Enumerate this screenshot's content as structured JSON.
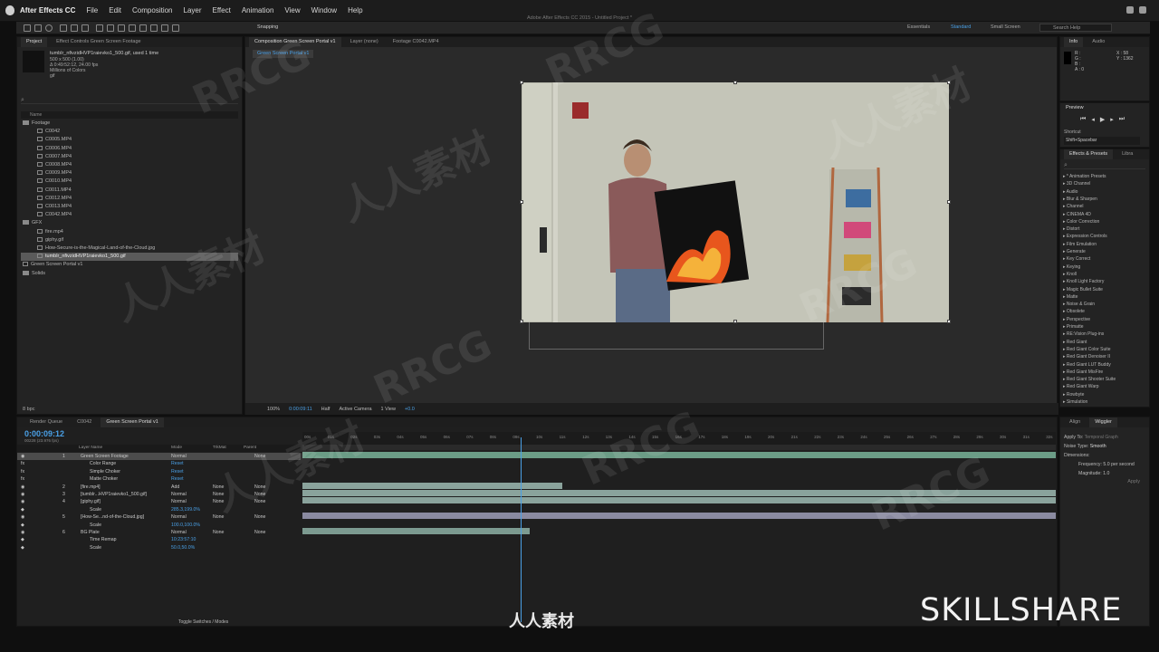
{
  "menubar": {
    "app": "After Effects CC",
    "items": [
      "File",
      "Edit",
      "Composition",
      "Layer",
      "Effect",
      "Animation",
      "View",
      "Window",
      "Help"
    ],
    "window_title": "Adobe After Effects CC 2015 - Untitled Project *"
  },
  "toolbar": {
    "snapping": "Snapping",
    "workspaces": [
      "Essentials",
      "Standard",
      "Small Screen"
    ],
    "active_workspace": "Standard",
    "search_help": "Search Help"
  },
  "project": {
    "tabs": [
      "Project",
      "Effect Controls Green Screen Footage"
    ],
    "file_name": "tumblr_nfivzidHVP1raievko1_500.gif",
    "used": ", used 1 time",
    "info_lines": [
      "500 x 500 (1.00)",
      "Δ 0:49:52:12, 24.00 fps",
      "Millions of Colors",
      "gif"
    ],
    "column_name": "Name",
    "items": [
      {
        "label": "Footage",
        "type": "folder",
        "indent": 0
      },
      {
        "label": "C0042",
        "type": "file",
        "indent": 1
      },
      {
        "label": "C0005.MP4",
        "type": "file",
        "indent": 1
      },
      {
        "label": "C0006.MP4",
        "type": "file",
        "indent": 1
      },
      {
        "label": "C0007.MP4",
        "type": "file",
        "indent": 1
      },
      {
        "label": "C0008.MP4",
        "type": "file",
        "indent": 1
      },
      {
        "label": "C0009.MP4",
        "type": "file",
        "indent": 1
      },
      {
        "label": "C0010.MP4",
        "type": "file",
        "indent": 1
      },
      {
        "label": "C0011.MP4",
        "type": "file",
        "indent": 1
      },
      {
        "label": "C0012.MP4",
        "type": "file",
        "indent": 1
      },
      {
        "label": "C0013.MP4",
        "type": "file",
        "indent": 1
      },
      {
        "label": "C0042.MP4",
        "type": "file",
        "indent": 1
      },
      {
        "label": "GFX",
        "type": "folder",
        "indent": 0
      },
      {
        "label": "fire.mp4",
        "type": "file",
        "indent": 1
      },
      {
        "label": "giphy.gif",
        "type": "file",
        "indent": 1
      },
      {
        "label": "How-Secure-is-the-Magical-Land-of-the-Cloud.jpg",
        "type": "file",
        "indent": 1
      },
      {
        "label": "tumblr_nfivzidHVP1raievko1_500.gif",
        "type": "file",
        "indent": 1
      },
      {
        "label": "Green Screen Portal v1",
        "type": "comp",
        "indent": 0
      },
      {
        "label": "Solids",
        "type": "folder",
        "indent": 0
      }
    ],
    "bpc": "8 bpc"
  },
  "viewer": {
    "tabs": [
      "Composition Green Screen Portal v1",
      "Layer (none)",
      "Footage C0042.MP4"
    ],
    "subtab": "Green Screen Portal v1",
    "zoom": "100%",
    "timecode": "0:00:09:11",
    "resolution": "Half",
    "camera": "Active Camera",
    "views": "1 View",
    "exposure": "+0.0"
  },
  "info": {
    "tabs": [
      "Info",
      "Audio"
    ],
    "r": "R :",
    "g": "G :",
    "b": "B :",
    "a": "A : 0",
    "x": "X : 58",
    "y": "Y : 1362"
  },
  "preview": {
    "title": "Preview",
    "shortcut_label": "Shortcut",
    "shortcut": "Shift+Spacebar"
  },
  "effects": {
    "tabs": [
      "Effects & Presets",
      "Libra"
    ],
    "items": [
      "* Animation Presets",
      "3D Channel",
      "Audio",
      "Blur & Sharpen",
      "Channel",
      "CINEMA 4D",
      "Color Correction",
      "Distort",
      "Expression Controls",
      "Film Emulation",
      "Generate",
      "Key Correct",
      "Keying",
      "Knoll",
      "Knoll Light Factory",
      "Magic Bullet Suite",
      "Matte",
      "Noise & Grain",
      "Obsolete",
      "Perspective",
      "Primatte",
      "RE:Vision Plug-ins",
      "Red Giant",
      "Red Giant Color Suite",
      "Red Giant Denoiser II",
      "Red Giant LUT Buddy",
      "Red Giant MisFire",
      "Red Giant Shooter Suite",
      "Red Giant Warp",
      "Rowbyte",
      "Simulation"
    ]
  },
  "wiggler": {
    "tabs": [
      "Align",
      "Wiggler"
    ],
    "apply_to_label": "Apply To:",
    "apply_to": "Temporal Graph",
    "noise_label": "Noise Type:",
    "noise": "Smooth",
    "dimensions_label": "Dimensions:",
    "frequency_label": "Frequency:",
    "frequency": "5.0",
    "frequency_unit": "per second",
    "magnitude_label": "Magnitude:",
    "magnitude": "1.0",
    "apply": "Apply"
  },
  "timeline": {
    "tabs": [
      "Render Queue",
      "C0042",
      "Green Screen Portal v1"
    ],
    "timecode": "0:00:09:12",
    "timecode_sub": "00228 (23.976 fps)",
    "columns": {
      "name": "Layer Name",
      "mode": "Mode",
      "trkmat": "TrkMat",
      "parent": "Parent"
    },
    "ruler": [
      "00s",
      "01s",
      "02s",
      "03s",
      "04s",
      "05s",
      "06s",
      "07s",
      "08s",
      "09s",
      "10s",
      "11s",
      "12s",
      "13s",
      "14s",
      "15s",
      "16s",
      "17s",
      "18s",
      "19s",
      "20s",
      "21s",
      "22s",
      "23s",
      "24s",
      "25s",
      "26s",
      "27s",
      "28s",
      "29s",
      "30s",
      "31s",
      "32s"
    ],
    "toggle_label": "Toggle Switches / Modes",
    "playhead_seconds": 9.4,
    "rows": [
      {
        "num": "1",
        "name": "Green Screen Footage",
        "mode": "Normal",
        "trk": "",
        "parent": "None",
        "kind": "layer",
        "selected": true,
        "bar_start": 0,
        "bar_end": 32.5,
        "bar_color": "#6b9c86"
      },
      {
        "num": "",
        "name": "Color Range",
        "prop_value": "Reset",
        "kind": "effect"
      },
      {
        "num": "",
        "name": "Simple Choker",
        "prop_value": "Reset",
        "kind": "effect"
      },
      {
        "num": "",
        "name": "Matte Choker",
        "prop_value": "Reset",
        "kind": "effect"
      },
      {
        "num": "2",
        "name": "[fire.mp4]",
        "mode": "Add",
        "trk": "None",
        "parent": "None",
        "kind": "layer",
        "bar_start": 0,
        "bar_end": 11.2,
        "bar_color": "#8aa39c"
      },
      {
        "num": "3",
        "name": "[tumblr...HVP1raievko1_500.gif]",
        "mode": "Normal",
        "trk": "None",
        "parent": "None",
        "kind": "layer",
        "bar_start": 0,
        "bar_end": 32.5,
        "bar_color": "#8aa39c"
      },
      {
        "num": "4",
        "name": "[giphy.gif]",
        "mode": "Normal",
        "trk": "None",
        "parent": "None",
        "kind": "layer",
        "bar_start": 0,
        "bar_end": 32.5,
        "bar_color": "#8aa39c"
      },
      {
        "num": "",
        "name": "Scale",
        "prop_value": "285.3,199.0%",
        "kind": "prop"
      },
      {
        "num": "5",
        "name": "[How-Se...nd-of-the-Cloud.jpg]",
        "mode": "Normal",
        "trk": "None",
        "parent": "None",
        "kind": "layer",
        "bar_start": 0,
        "bar_end": 32.5,
        "bar_color": "#8a8aa0"
      },
      {
        "num": "",
        "name": "Scale",
        "prop_value": "100.0,100.0%",
        "kind": "prop"
      },
      {
        "num": "6",
        "name": "BG Plate",
        "mode": "Normal",
        "trk": "None",
        "parent": "None",
        "kind": "layer",
        "bar_start": 0,
        "bar_end": 9.8,
        "bar_color": "#7c9a90"
      },
      {
        "num": "",
        "name": "Time Remap",
        "prop_value": "10:23:57:10",
        "kind": "prop"
      },
      {
        "num": "",
        "name": "Scale",
        "prop_value": "50.0,50.0%",
        "kind": "prop"
      }
    ]
  },
  "overlay": {
    "brand": "SKILLSHARE",
    "watermark_bottom": "人人素材",
    "watermarks": [
      "RRCG",
      "人人素材",
      "RRCG",
      "人人素材",
      "RRCG",
      "人人素材",
      "RRCG",
      "人人素材",
      "RRCG",
      "RRCG"
    ]
  }
}
